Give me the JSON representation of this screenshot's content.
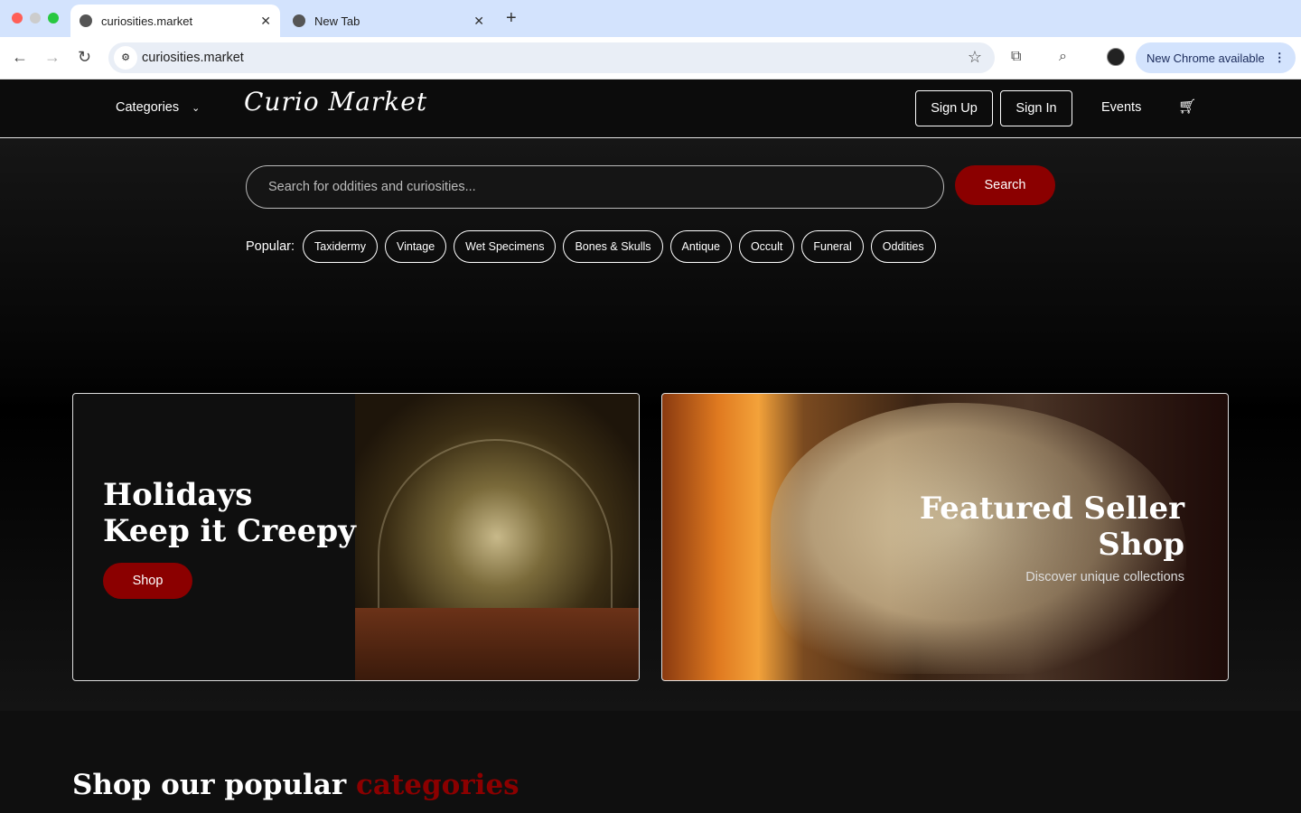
{
  "browser": {
    "tabs": [
      {
        "label": "curiosities.market",
        "active": true
      },
      {
        "label": "New Tab",
        "active": false
      }
    ],
    "url": "curiosities.market",
    "update_button": "New Chrome available"
  },
  "header": {
    "categories_label": "Categories",
    "logo": "Curio Market",
    "sign_up": "Sign Up",
    "sign_in": "Sign In",
    "events": "Events"
  },
  "search": {
    "placeholder": "Search for oddities and curiosities...",
    "button": "Search",
    "popular_label": "Popular:",
    "popular_tags": [
      "Taxidermy",
      "Vintage",
      "Wet Specimens",
      "Bones & Skulls",
      "Antique",
      "Occult",
      "Funeral",
      "Oddities"
    ]
  },
  "promos": [
    {
      "title_line1": "Holidays",
      "title_line2": "Keep it Creepy",
      "button": "Shop"
    },
    {
      "title_line1": "Featured Seller",
      "title_line2": "Shop",
      "subtitle": "Discover unique collections"
    }
  ],
  "popular_section": {
    "title_prefix": "Shop our popular",
    "title_accent": "categories"
  },
  "colors": {
    "accent": "#8b0000",
    "background": "#0e0e0e"
  }
}
